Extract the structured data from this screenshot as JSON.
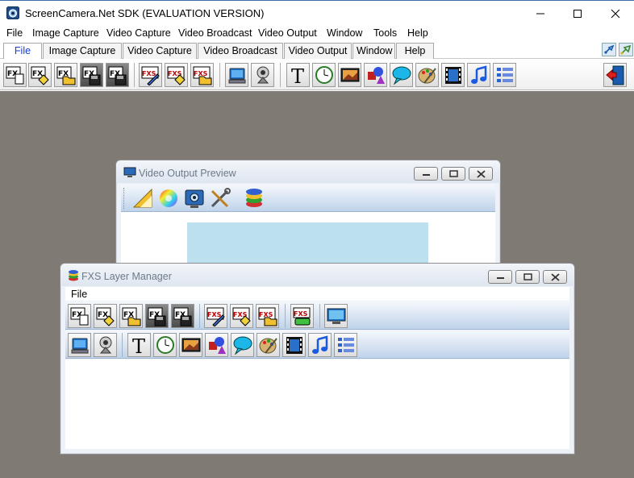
{
  "window": {
    "title": "ScreenCamera.Net SDK (EVALUATION VERSION)"
  },
  "menu": {
    "items": [
      "File",
      "Image Capture",
      "Video Capture",
      "Video Broadcast",
      "Video Output",
      "Window",
      "Tools",
      "Help"
    ]
  },
  "tabs": {
    "items": [
      "File",
      "Image Capture",
      "Video Capture",
      "Video Broadcast",
      "Video Output",
      "Window",
      "Help"
    ],
    "active": "File"
  },
  "toolbar": {
    "fx_label": "FX",
    "fxs_label": "FXS",
    "text_tool": "T"
  },
  "preview_window": {
    "title": "Video Output Preview",
    "preview_color": "#bde0ee"
  },
  "layer_manager": {
    "title": "FXS Layer Manager",
    "menu_file": "File",
    "fx_label": "FX",
    "fxs_label": "FXS",
    "text_tool": "T"
  },
  "colors": {
    "workspace": "#807a75",
    "accent_tab": "#1a3cc8"
  }
}
